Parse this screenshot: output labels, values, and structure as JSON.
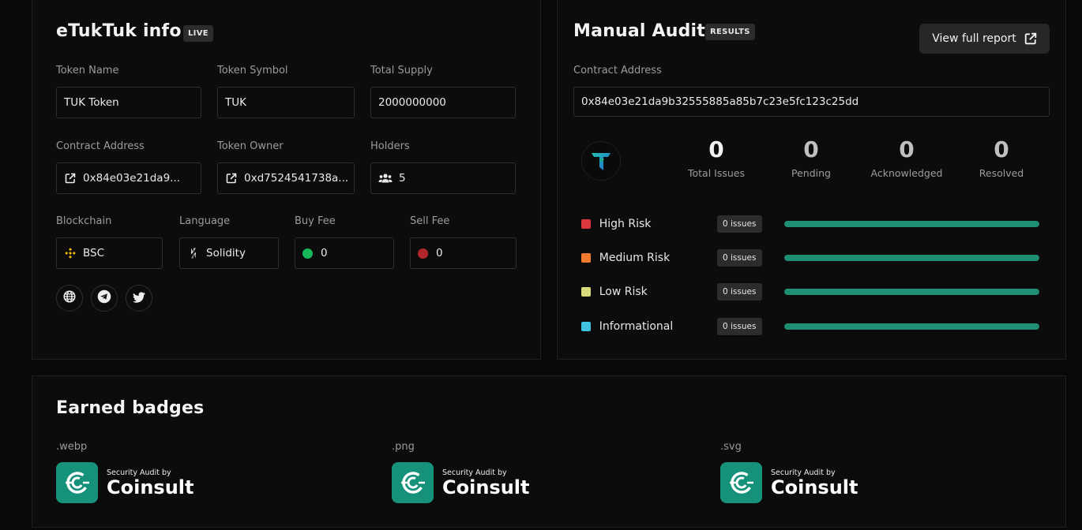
{
  "info": {
    "title": "eTukTuk info",
    "live_tag": "LIVE",
    "token_name_label": "Token Name",
    "token_name": "TUK Token",
    "token_symbol_label": "Token Symbol",
    "token_symbol": "TUK",
    "total_supply_label": "Total Supply",
    "total_supply": "2000000000",
    "contract_address_label": "Contract Address",
    "contract_address": "0x84e03e21da9...",
    "token_owner_label": "Token Owner",
    "token_owner": "0xd7524541738a...",
    "holders_label": "Holders",
    "holders": "5",
    "blockchain_label": "Blockchain",
    "blockchain": "BSC",
    "language_label": "Language",
    "language": "Solidity",
    "buy_fee_label": "Buy Fee",
    "buy_fee": "0",
    "sell_fee_label": "Sell Fee",
    "sell_fee": "0",
    "colors": {
      "buy_dot": "#16b85a",
      "sell_dot": "#b1262a",
      "bsc_yellow": "#f0b90b"
    },
    "socials": [
      "globe-icon",
      "telegram-icon",
      "twitter-icon"
    ]
  },
  "audit": {
    "title": "Manual Audit",
    "results_tag": "RESULTS",
    "view_report_label": "View full report",
    "contract_address_label": "Contract Address",
    "contract_address": "0x84e03e21da9b32555885a85b7c23e5fc123c25dd",
    "stats": [
      {
        "value": "0",
        "label": "Total Issues"
      },
      {
        "value": "0",
        "label": "Pending"
      },
      {
        "value": "0",
        "label": "Acknowledged"
      },
      {
        "value": "0",
        "label": "Resolved"
      }
    ],
    "risks": [
      {
        "label": "High Risk",
        "badge": "0 issues",
        "color": "#d9363e",
        "progress": 1.0
      },
      {
        "label": "Medium Risk",
        "badge": "0 issues",
        "color": "#f07b2f",
        "progress": 1.0
      },
      {
        "label": "Low Risk",
        "badge": "0 issues",
        "color": "#d8db7a",
        "progress": 1.0
      },
      {
        "label": "Informational",
        "badge": "0 issues",
        "color": "#3ec3e0",
        "progress": 1.0
      }
    ],
    "bar_color": "#1f8f74"
  },
  "badges": {
    "title": "Earned badges",
    "items": [
      {
        "ext": ".webp",
        "small": "Security Audit by",
        "brand": "Coinsult"
      },
      {
        "ext": ".png",
        "small": "Security Audit by",
        "brand": "Coinsult"
      },
      {
        "ext": ".svg",
        "small": "Security Audit by",
        "brand": "Coinsult"
      }
    ],
    "brand_color": "#17927a"
  }
}
